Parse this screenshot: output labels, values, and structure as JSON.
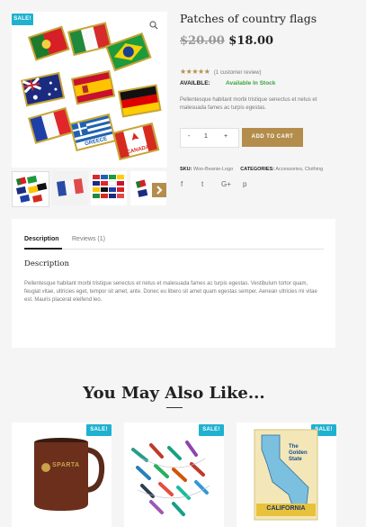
{
  "product": {
    "badge": "SALE!",
    "title": "Patches of country flags",
    "old_price": "$20.00",
    "price": "$18.00",
    "stars": "★★★★★",
    "reviews_link": "(1 customer review)",
    "availability_label": "AVAILBLE:",
    "availability_value": "Available In Stock",
    "short_desc": "Pellentesque habitant morbi tristique senectus et netus et malesuada fames ac turpis egestas.",
    "qty_minus": "-",
    "qty": "1",
    "qty_plus": "+",
    "add_to_cart": "ADD TO CART",
    "sku_label": "SKU:",
    "sku_value": "Woo-Beanie-Logo",
    "categories_label": "CATEGORIES:",
    "cat1": "Accessories",
    "cat_sep": ",",
    "cat2": "Clothing",
    "social": {
      "facebook": "f",
      "twitter": "t",
      "gplus": "G+",
      "pinterest": "p"
    },
    "zoom_icon": "search-icon",
    "next_icon": "chevron-right-icon"
  },
  "tabs": {
    "description_tab": "Description",
    "reviews_tab": "Reviews (1)",
    "heading": "Description",
    "body": "Pellentesque habitant morbi tristique senectus et netus et malesuada fames ac turpis egestas. Vestibulum tortor quam, feugiat vitae, ultricies eget, tempor sit amet, ante. Donec eu libero sit amet quam egestas semper. Aenean ultricies mi vitae est. Mauris placerat eleifend leo."
  },
  "related": {
    "title": "You May Also Like...",
    "items": [
      {
        "badge": "SALE!",
        "mug_text": "SPARTA"
      },
      {
        "badge": "SALE!"
      },
      {
        "badge": "SALE!",
        "map_top": "The Golden State",
        "map_bottom": "CALIFORNIA"
      }
    ]
  },
  "image": {
    "flag_labels": [
      "GREECE",
      "CANADA"
    ]
  },
  "colors": {
    "sale": "#1fb1d0",
    "gold": "#b48d4c",
    "stock": "#3aa53a"
  }
}
